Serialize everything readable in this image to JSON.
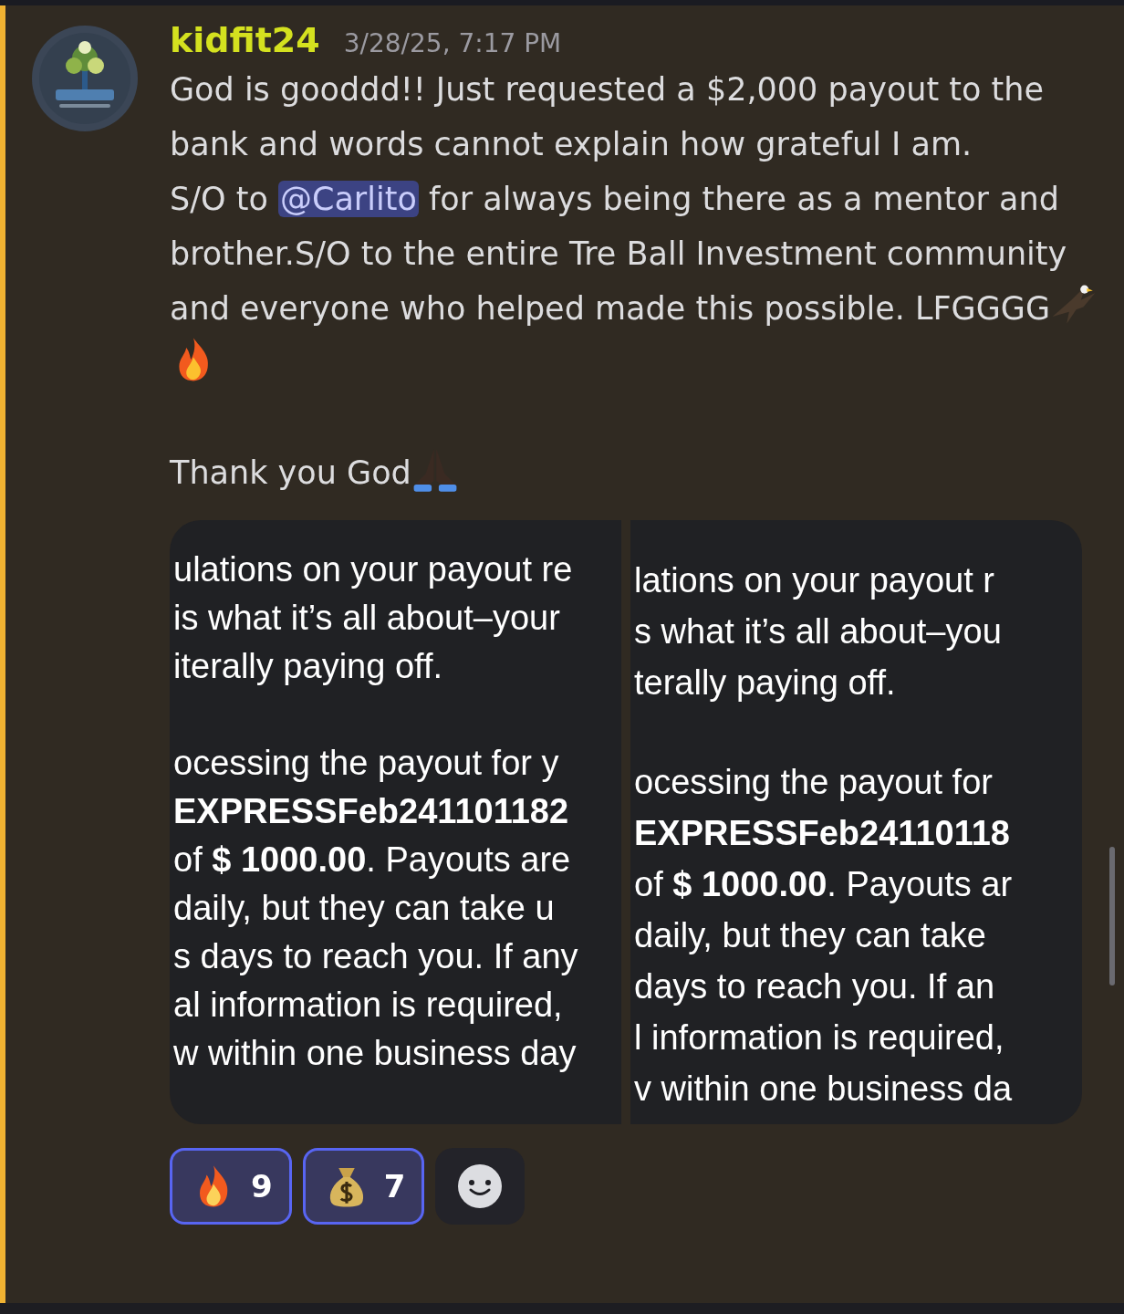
{
  "message": {
    "highlighted": true,
    "author": "kidfit24",
    "timestamp": "3/28/25, 7:17 PM",
    "paragraphs": [
      {
        "segments": [
          {
            "kind": "text",
            "text": "God is gooddd!! Just requested a $2,000 payout to the bank and words cannot explain how grateful I am."
          }
        ]
      },
      {
        "segments": [
          {
            "kind": "text",
            "text": "S/O to "
          },
          {
            "kind": "mention",
            "text": "@Carlito"
          },
          {
            "kind": "text",
            "text": " for always being there as a mentor and brother.S/O to the entire Tre Ball Investment community and everyone who helped made this possible.  LFGGGG"
          },
          {
            "kind": "eagle"
          },
          {
            "kind": "fire"
          }
        ]
      },
      {
        "segments": [
          {
            "kind": "break"
          }
        ]
      },
      {
        "segments": [
          {
            "kind": "text",
            "text": "Thank you God"
          },
          {
            "kind": "pray"
          }
        ]
      }
    ],
    "attachments": [
      {
        "lines": [
          {
            "kind": "text",
            "text": "ulations on your payout re"
          },
          {
            "kind": "text",
            "text": "is what it’s all about–your"
          },
          {
            "kind": "text",
            "text": "iterally paying off."
          },
          {
            "kind": "gap"
          },
          {
            "kind": "text",
            "text": "ocessing the payout for y"
          },
          {
            "kind": "bold",
            "text": "EXPRESSFeb241101182"
          },
          {
            "kind": "text",
            "text": "of **$ 1000.00**. Payouts are"
          },
          {
            "kind": "text",
            "text": "daily, but they can take u"
          },
          {
            "kind": "text",
            "text": "s days to reach you. If any"
          },
          {
            "kind": "text",
            "text": "al information is required,"
          },
          {
            "kind": "text",
            "text": "w within one business day"
          }
        ]
      },
      {
        "lines": [
          {
            "kind": "text",
            "text": "lations on your payout r"
          },
          {
            "kind": "text",
            "text": "s what it’s all about–you"
          },
          {
            "kind": "text",
            "text": "terally paying off."
          },
          {
            "kind": "gap"
          },
          {
            "kind": "text",
            "text": "ocessing the payout for"
          },
          {
            "kind": "bold",
            "text": "EXPRESSFeb24110118"
          },
          {
            "kind": "text",
            "text": "of **$ 1000.00**. Payouts ar"
          },
          {
            "kind": "text",
            "text": "daily, but they can take"
          },
          {
            "kind": "text",
            "text": "days to reach you. If an"
          },
          {
            "kind": "text",
            "text": "l information is required,"
          },
          {
            "kind": "text",
            "text": "v within one business da"
          }
        ]
      }
    ],
    "reactions": [
      {
        "kind": "fire",
        "count": "9",
        "selected": true
      },
      {
        "kind": "money",
        "count": "7",
        "selected": true
      }
    ]
  }
}
